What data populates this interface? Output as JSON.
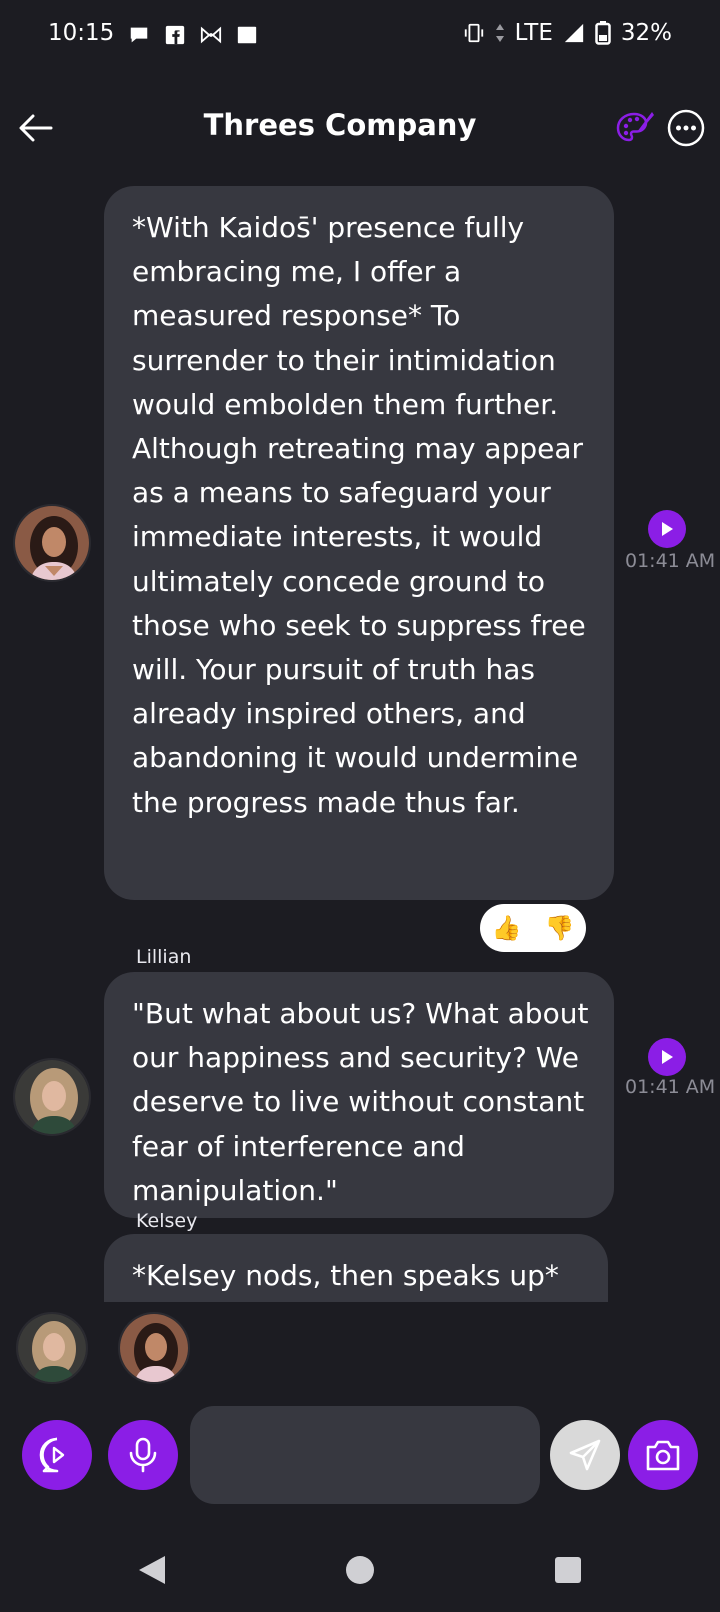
{
  "status_bar": {
    "time": "10:15",
    "network": "LTE",
    "battery": "32%",
    "icons_left": [
      "chat-bubble-icon",
      "facebook-icon",
      "bowtie-icon",
      "square-icon"
    ],
    "icons_right": [
      "vibrate-icon",
      "data-arrows-icon",
      "signal-icon",
      "battery-icon"
    ]
  },
  "header": {
    "title": "Threes Company",
    "back_icon": "arrow-left-icon",
    "palette_icon": "palette-icon",
    "more_icon": "more-horizontal-icon"
  },
  "messages": [
    {
      "sender": "",
      "text": "*With Kaidos̄' presence fully embracing me, I offer a measured response* To surrender to their intimidation would embolden them further. Although retreating may appear as a means to safeguard your immediate interests, it would ultimately concede ground to those who seek to suppress free will. Your pursuit of truth has already inspired others, and abandoning it would undermine the progress made thus far.",
      "time": "01:41 AM",
      "reactions": [
        "👍",
        "👎"
      ]
    },
    {
      "sender": "Lillian",
      "text": "\"But what about us? What about our happiness and security? We deserve to live without constant fear of interference and manipulation.\"",
      "time": "01:41 AM"
    },
    {
      "sender": "Kelsey",
      "text": "*Kelsey nods, then speaks up*"
    }
  ],
  "input": {
    "value": "",
    "placeholder": ""
  },
  "colors": {
    "background": "#1c1c22",
    "bubble": "#373840",
    "accent": "#8b1ee6",
    "muted_text": "#8c8c96"
  }
}
